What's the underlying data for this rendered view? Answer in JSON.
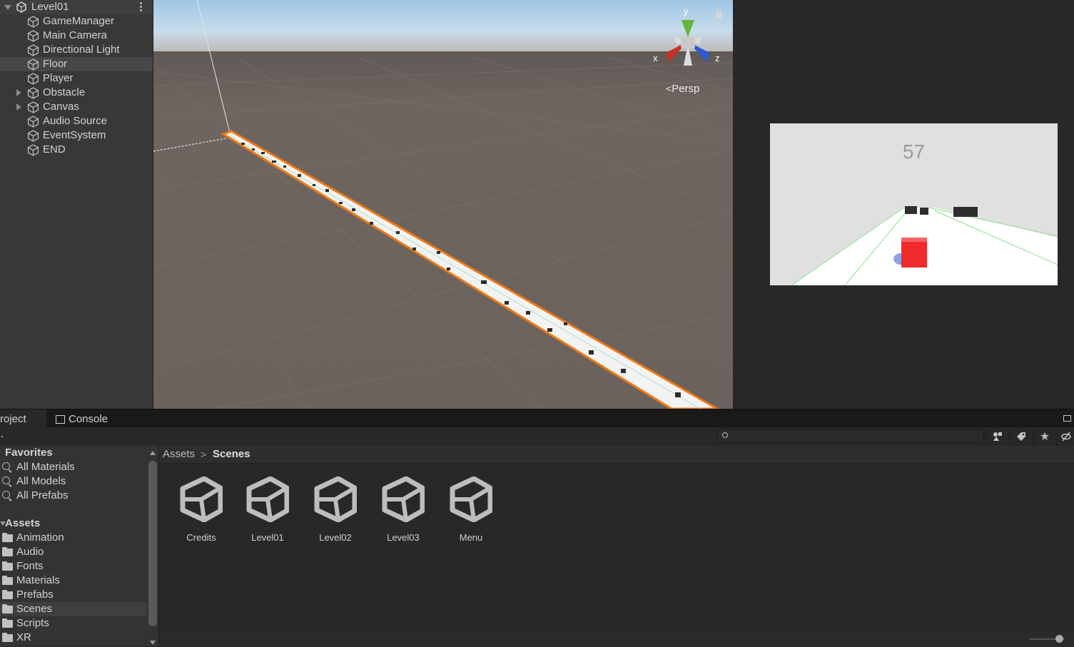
{
  "hierarchy": {
    "scene_name": "Level01",
    "items": [
      {
        "label": "GameManager"
      },
      {
        "label": "Main Camera"
      },
      {
        "label": "Directional Light"
      },
      {
        "label": "Floor"
      },
      {
        "label": "Player"
      },
      {
        "label": "Obstacle"
      },
      {
        "label": "Canvas"
      },
      {
        "label": "Audio Source"
      },
      {
        "label": "EventSystem"
      },
      {
        "label": "END"
      }
    ]
  },
  "scene_view": {
    "projection_label": "Persp",
    "gizmo_axes": {
      "x": "x",
      "y": "y",
      "z": "z"
    }
  },
  "game_view": {
    "score": "57"
  },
  "bottom_panel": {
    "tabs": [
      {
        "label": "roject"
      },
      {
        "label": "Console"
      }
    ],
    "sidebar": {
      "favorites_label": "Favorites",
      "favorites": [
        {
          "label": "All Materials"
        },
        {
          "label": "All Models"
        },
        {
          "label": "All Prefabs"
        }
      ],
      "assets_label": "Assets",
      "folders": [
        {
          "label": "Animation"
        },
        {
          "label": "Audio"
        },
        {
          "label": "Fonts"
        },
        {
          "label": "Materials"
        },
        {
          "label": "Prefabs"
        },
        {
          "label": "Scenes"
        },
        {
          "label": "Scripts"
        },
        {
          "label": "XR"
        }
      ]
    },
    "breadcrumb": {
      "root": "Assets",
      "current": "Scenes"
    },
    "assets": [
      {
        "name": "Credits"
      },
      {
        "name": "Level01"
      },
      {
        "name": "Level02"
      },
      {
        "name": "Level03"
      },
      {
        "name": "Menu"
      }
    ]
  }
}
